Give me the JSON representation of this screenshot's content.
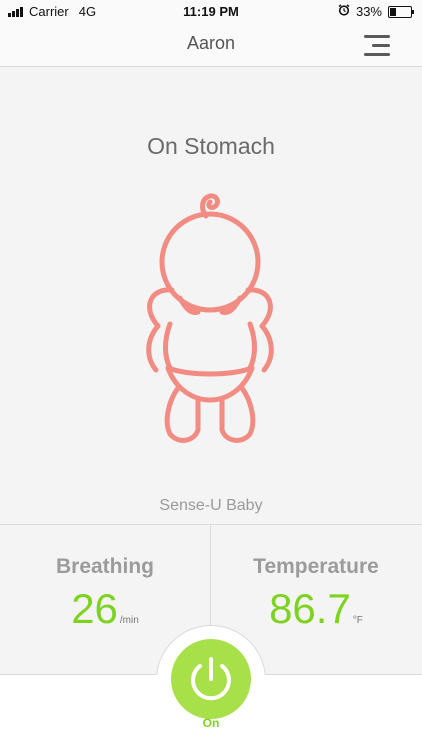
{
  "status_bar": {
    "carrier": "Carrier",
    "network": "4G",
    "time": "11:19 PM",
    "battery": "33%",
    "battery_level": 0.33,
    "alarm_icon": "alarm-clock-icon"
  },
  "header": {
    "title": "Aaron",
    "menu_icon": "hamburger-menu-icon"
  },
  "monitor": {
    "position": "On Stomach",
    "device_name": "Sense-U Baby",
    "illustration_color": "#f28b82"
  },
  "stats": {
    "breathing": {
      "label": "Breathing",
      "value": "26",
      "unit": "/min"
    },
    "temperature": {
      "label": "Temperature",
      "value": "86.7",
      "unit": "°F"
    }
  },
  "power": {
    "label": "On",
    "color": "#a8e04a",
    "icon": "power-icon"
  }
}
